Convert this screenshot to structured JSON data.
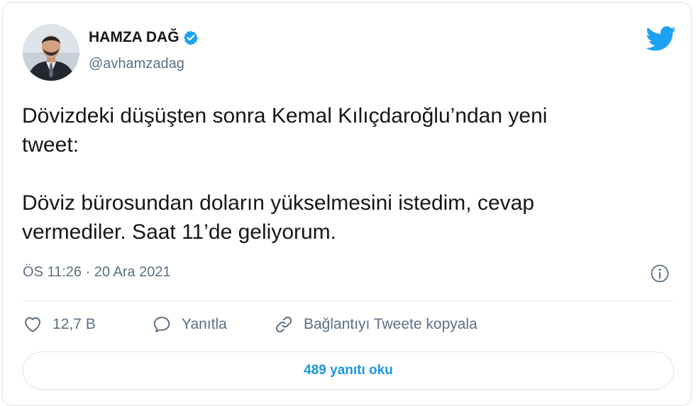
{
  "author": {
    "name": "HAMZA DAĞ",
    "handle": "@avhamzadag"
  },
  "tweet": {
    "text": "Dövizdeki düşüşten sonra Kemal Kılıçdaroğlu’ndan yeni\ntweet:\n\nDöviz bürosundan doların yükselmesini istedim, cevap\nvermediler. Saat 11’de geliyorum.",
    "timestamp": "ÖS 11:26 · 20 Ara 2021"
  },
  "actions": {
    "like_count": "12,7 B",
    "reply_label": "Yanıtla",
    "copy_link_label": "Bağlantıyı Tweete kopyala"
  },
  "replies_button": {
    "label": "489 yanıtı oku"
  },
  "icons": {
    "verified": "verified-badge-icon",
    "brand": "twitter-bird-icon",
    "info": "info-icon",
    "like": "heart-icon",
    "reply": "speech-bubble-icon",
    "link": "link-icon"
  },
  "colors": {
    "brand_blue": "#1da1f2",
    "link_blue": "#1b95e0",
    "muted_text": "#5b7083",
    "main_text": "#14171a",
    "border": "#dfe3e6"
  }
}
